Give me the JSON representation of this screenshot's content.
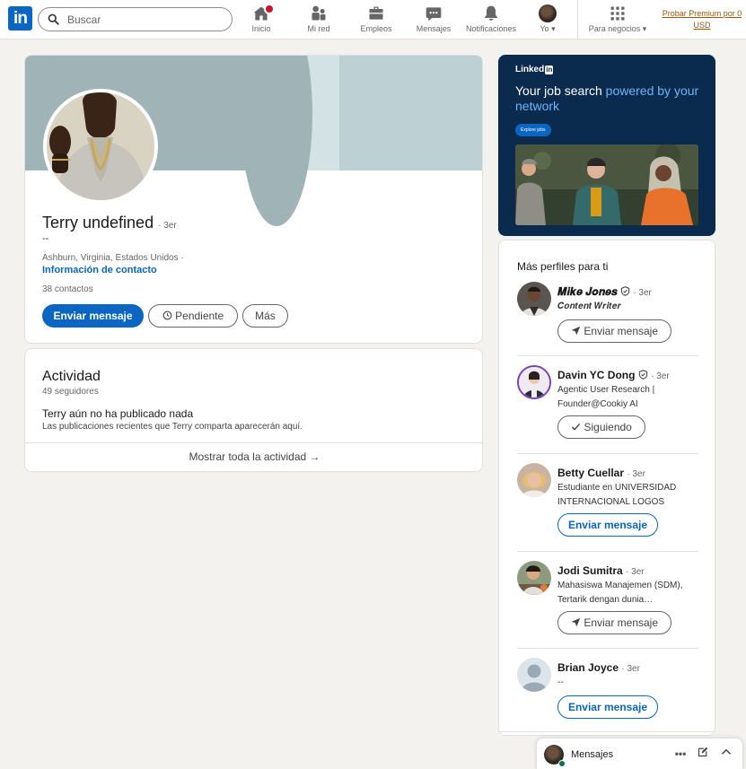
{
  "nav": {
    "logo": "in",
    "search_placeholder": "Buscar",
    "items": [
      {
        "label": "Inicio",
        "icon": "home-icon"
      },
      {
        "label": "Mi red",
        "icon": "people-icon"
      },
      {
        "label": "Empleos",
        "icon": "briefcase-icon"
      },
      {
        "label": "Mensajes",
        "icon": "chat-icon"
      },
      {
        "label": "Notificaciones",
        "icon": "bell-icon"
      },
      {
        "label": "Yo",
        "icon": "avatar"
      }
    ],
    "business_label": "Para negocios",
    "premium_label": "Probar Premium por 0 USD",
    "premium_line1": "Probar Premium por 0",
    "premium_line2": "USD"
  },
  "profile": {
    "name": "Terry undefined",
    "degree": "· 3er",
    "headline": "--",
    "location": "Ashburn, Virginia, Estados Unidos ·",
    "contact_info": "Información de contacto",
    "connections": "38 contactos",
    "buttons": {
      "message": "Enviar mensaje",
      "pending": "Pendiente",
      "more": "Más"
    }
  },
  "activity": {
    "title": "Actividad",
    "followers": "49 seguidores",
    "empty_title": "Terry aún no ha publicado nada",
    "empty_sub": "Las publicaciones recientes que Terry comparta aparecerán aquí.",
    "show_all": "Mostrar toda la actividad →"
  },
  "ad": {
    "brand": "Linked",
    "brand_in": "in",
    "headline_white": "Your job search ",
    "headline_blue": "powered by your network",
    "button": "Explore jobs"
  },
  "people_panel": {
    "title": "Más perfiles para ti",
    "people": [
      {
        "name": "𝑴𝒊𝒌𝒆 𝑱𝒐𝒏𝒆𝒔",
        "degree": "· 3er",
        "headline": "𝑪𝒐𝒏𝒕𝒆𝒏𝒕 𝑾𝒓𝒊𝒕𝒆𝒓",
        "action": "Enviar mensaje",
        "verified": true
      },
      {
        "name": "Davin YC Dong",
        "degree": "· 3er",
        "headline": "Agentic User Research | Founder@Cookiy AI",
        "action": "Siguiendo",
        "verified": true
      },
      {
        "name": "Betty Cuellar",
        "degree": "· 3er",
        "headline": "Estudiante en UNIVERSIDAD INTERNACIONAL LOGOS",
        "action": "Enviar mensaje",
        "verified": false
      },
      {
        "name": "Jodi Sumitra",
        "degree": "· 3er",
        "headline": "Mahasiswa Manajemen (SDM), Tertarik dengan dunia…",
        "action": "Enviar mensaje",
        "verified": false
      },
      {
        "name": "Brian Joyce",
        "degree": "· 3er",
        "headline": "--",
        "action": "Enviar mensaje",
        "verified": false
      }
    ]
  },
  "messaging": {
    "label": "Mensajes"
  },
  "colors": {
    "brand": "#0a66c2",
    "page_bg": "#f4f2ee",
    "notification_badge": "#cb112d",
    "premium": "#915907"
  }
}
